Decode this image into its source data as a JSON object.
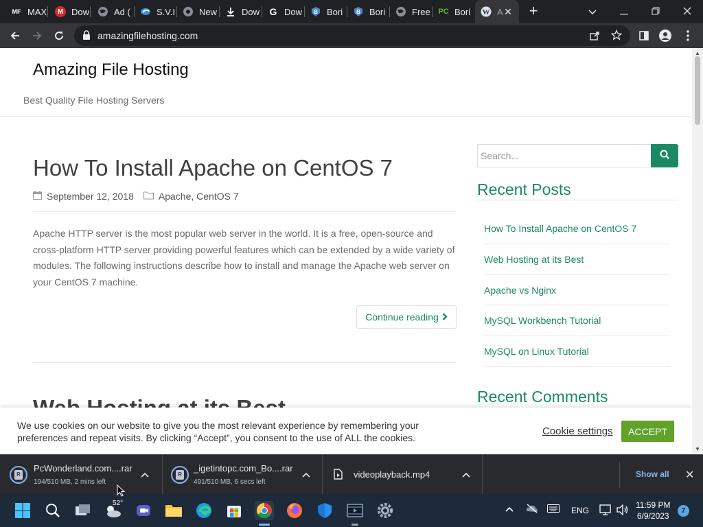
{
  "browser": {
    "tabs": [
      {
        "title": "MAX",
        "icon": "mf-icon",
        "color": "#ffffff",
        "text": "MF"
      },
      {
        "title": "Dow",
        "icon": "mega-icon",
        "color": "#d9272e",
        "text": "M"
      },
      {
        "title": "Ad (",
        "icon": "globe-icon",
        "color": "#8a8f98",
        "text": ""
      },
      {
        "title": "S.V.I",
        "icon": "sv-icon",
        "color": "#3a8fd8",
        "text": ""
      },
      {
        "title": "New",
        "icon": "chrome-icon",
        "color": "#8a8f98",
        "text": ""
      },
      {
        "title": "Dow",
        "icon": "download-icon",
        "color": "#e8eaed",
        "text": ""
      },
      {
        "title": "Dow",
        "icon": "g-icon",
        "color": "#ffffff",
        "text": "G"
      },
      {
        "title": "Bori",
        "icon": "bori-icon",
        "color": "#4a86c8",
        "text": "B"
      },
      {
        "title": "Bori",
        "icon": "bori-icon",
        "color": "#4a86c8",
        "text": "B"
      },
      {
        "title": "Free",
        "icon": "globe-icon",
        "color": "#8a8f98",
        "text": ""
      },
      {
        "title": "Bori",
        "icon": "pc-icon",
        "color": "#5cb82e",
        "text": "PC"
      },
      {
        "title": "A",
        "icon": "wordpress-icon",
        "color": "#dbe6f2",
        "text": "W",
        "active": true
      }
    ],
    "url": "amazingfilehosting.com"
  },
  "site": {
    "title": "Amazing File Hosting",
    "tagline": "Best Quality File Hosting Servers"
  },
  "post": {
    "title": "How To Install Apache on CentOS 7",
    "date": "September 12, 2018",
    "categories": "Apache, CentOS 7",
    "excerpt": "Apache HTTP server is the most popular web server in the world. It is a free, open-source and cross-platform HTTP server providing powerful features which can be extended by a wide variety of modules. The following instructions describe how to install and manage the Apache web server on your CentOS 7 machine.",
    "continue_label": "Continue reading",
    "next_title": "Web Hosting at its Best"
  },
  "sidebar": {
    "search_placeholder": "Search...",
    "recent_posts_title": "Recent Posts",
    "recent_posts": [
      "How To Install Apache on CentOS 7",
      "Web Hosting at its Best",
      "Apache vs Nginx",
      "MySQL Workbench Tutorial",
      "MySQL on Linux Tutorial"
    ],
    "recent_comments_title": "Recent Comments"
  },
  "cookie": {
    "text": "We use cookies on our website to give you the most relevant experience by remembering your preferences and repeat visits. By clicking “Accept”, you consent to the use of ALL the cookies.",
    "settings_label": "Cookie settings",
    "accept_label": "ACCEPT"
  },
  "downloads": {
    "items": [
      {
        "name": "PcWonderland.com....rar",
        "status": "194/510 MB, 2 mins left"
      },
      {
        "name": "_igetintopc.com_Bo....rar",
        "status": "491/510 MB, 6 secs left"
      },
      {
        "name": "videoplayback.mp4",
        "status": ""
      }
    ],
    "show_all_label": "Show all"
  },
  "taskbar": {
    "weather_temp": "52°",
    "language": "ENG",
    "time": "11:59 PM",
    "date": "6/9/2023",
    "notification_count": "7"
  },
  "colors": {
    "accent": "#1a8a63",
    "accept": "#61a229",
    "chrome_dark": "#202124",
    "chrome_toolbar": "#35363a",
    "taskbar": "#1d2a3a"
  }
}
